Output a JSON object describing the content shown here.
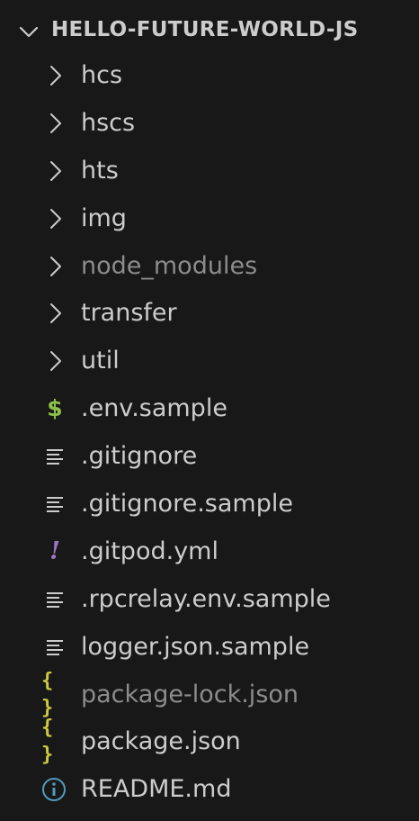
{
  "explorer": {
    "section_title": "HELLO-FUTURE-WORLD-JS",
    "items": [
      {
        "label": "hcs",
        "type": "folder",
        "icon": "chevron-right-icon",
        "dim": false
      },
      {
        "label": "hscs",
        "type": "folder",
        "icon": "chevron-right-icon",
        "dim": false
      },
      {
        "label": "hts",
        "type": "folder",
        "icon": "chevron-right-icon",
        "dim": false
      },
      {
        "label": "img",
        "type": "folder",
        "icon": "chevron-right-icon",
        "dim": false
      },
      {
        "label": "node_modules",
        "type": "folder",
        "icon": "chevron-right-icon",
        "dim": true
      },
      {
        "label": "transfer",
        "type": "folder",
        "icon": "chevron-right-icon",
        "dim": false
      },
      {
        "label": "util",
        "type": "folder",
        "icon": "chevron-right-icon",
        "dim": false
      },
      {
        "label": ".env.sample",
        "type": "file",
        "icon": "dollar-icon",
        "glyph": "$",
        "dim": false
      },
      {
        "label": ".gitignore",
        "type": "file",
        "icon": "lines-icon",
        "dim": false
      },
      {
        "label": ".gitignore.sample",
        "type": "file",
        "icon": "lines-icon",
        "dim": false
      },
      {
        "label": ".gitpod.yml",
        "type": "file",
        "icon": "exclamation-icon",
        "glyph": "!",
        "dim": false
      },
      {
        "label": ".rpcrelay.env.sample",
        "type": "file",
        "icon": "lines-icon",
        "dim": false
      },
      {
        "label": "logger.json.sample",
        "type": "file",
        "icon": "lines-icon",
        "dim": false
      },
      {
        "label": "package-lock.json",
        "type": "file",
        "icon": "braces-icon",
        "glyph": "{ }",
        "dim": true
      },
      {
        "label": "package.json",
        "type": "file",
        "icon": "braces-icon",
        "glyph": "{ }",
        "dim": false
      },
      {
        "label": "README.md",
        "type": "file",
        "icon": "info-icon",
        "dim": false
      }
    ]
  },
  "colors": {
    "background": "#181818",
    "text": "#cccccc",
    "dim_text": "#8c8c8c",
    "dollar_icon": "#8dc149",
    "exclamation_icon": "#a074c4",
    "braces_icon": "#cbcb41",
    "info_icon": "#519aba"
  }
}
